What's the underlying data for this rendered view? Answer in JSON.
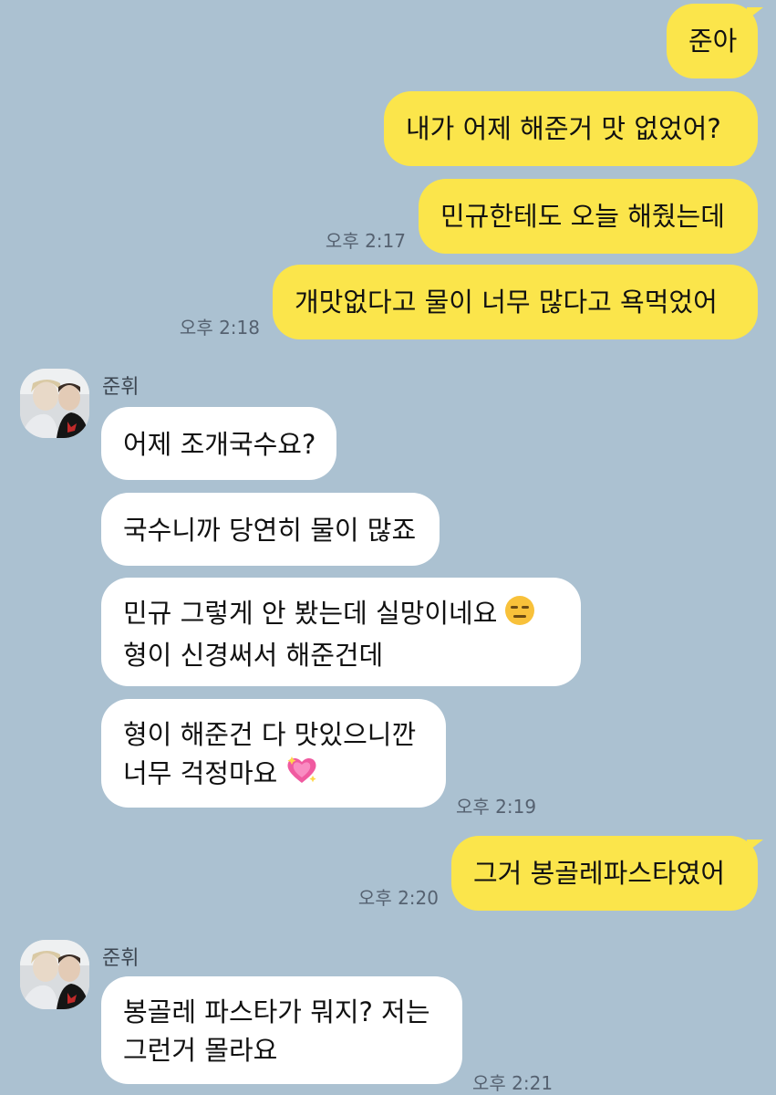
{
  "colors": {
    "background": "#abc1d1",
    "my_bubble": "#fbe54b",
    "their_bubble": "#ffffff"
  },
  "messages": [
    {
      "text": "준아"
    },
    {
      "text": "내가 어제 해준거 맛 없었어?"
    },
    {
      "text": "민규한테도 오늘 해줬는데",
      "time": "오후 2:17"
    },
    {
      "text": "개맛없다고 물이 너무 많다고 욕먹었어",
      "time": "오후 2:18"
    }
  ],
  "group1": {
    "sender": "준휘",
    "messages": [
      {
        "text": "어제 조개국수요?"
      },
      {
        "text": "국수니까 당연히 물이 많죠"
      },
      {
        "line1": "민규 그렇게 안 봤는데 실망이네요",
        "line2": "형이 신경써서 해준건데",
        "emoji": "expressionless-face-icon"
      },
      {
        "line1": "형이 해준건 다 맛있으니깐",
        "line2": "너무 걱정마요",
        "emoji": "sparkling-heart-icon",
        "time": "오후 2:19"
      }
    ]
  },
  "my_reply": {
    "text": "그거 봉골레파스타였어",
    "time": "오후 2:20"
  },
  "group2": {
    "sender": "준휘",
    "messages": [
      {
        "line1": "봉골레 파스타가 뭐지? 저는",
        "line2": "그런거 몰라요",
        "time": "오후 2:21"
      }
    ]
  }
}
